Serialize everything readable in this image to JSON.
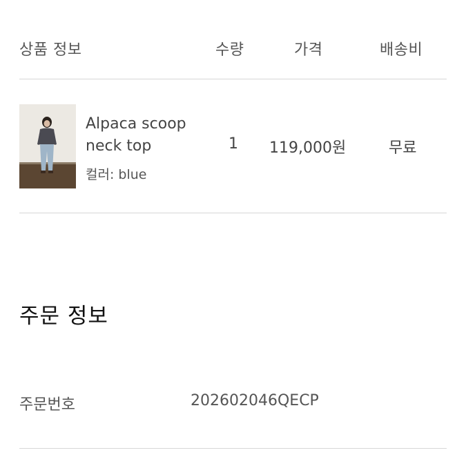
{
  "table": {
    "headers": {
      "product": "상품 정보",
      "quantity": "수량",
      "price": "가격",
      "shipping": "배송비"
    },
    "items": [
      {
        "name": "Alpaca scoop neck top",
        "option": "컬러: blue",
        "quantity": "1",
        "price": "119,000원",
        "shipping": "무료"
      }
    ]
  },
  "order_info": {
    "title": "주문 정보",
    "order_number_label": "주문번호",
    "order_number_value": "202602046QECP"
  }
}
